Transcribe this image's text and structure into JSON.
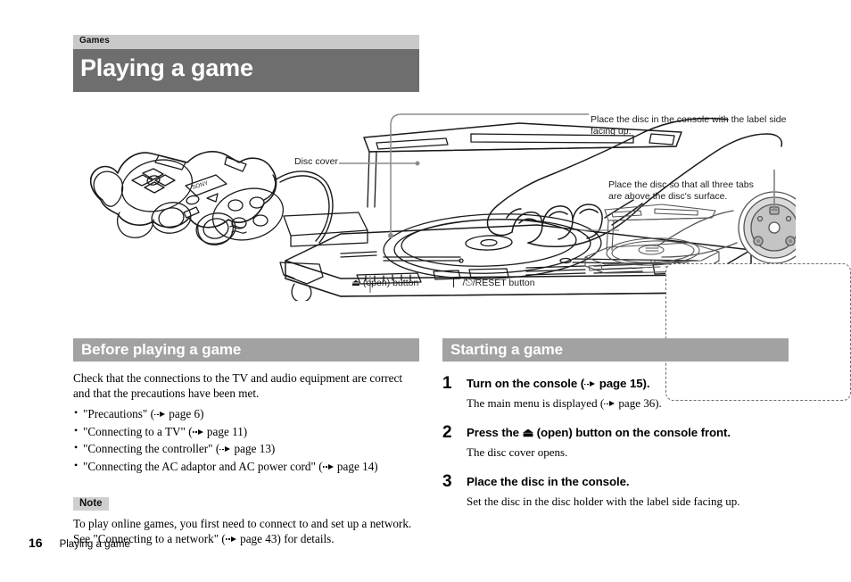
{
  "running_head": {
    "chapter": "Games",
    "title": "Playing a game"
  },
  "figure": {
    "callouts": {
      "top_right": "Place the disc in the console with the label side facing up.",
      "disc_cover": "Disc cover",
      "open_button": "(open) button",
      "open_button_icon": "eject-icon",
      "reset_button": "/RESET button",
      "reset_button_icon": "power-standby-icon"
    },
    "inset": {
      "text": "Place the disc so that all three tabs are above the disc's surface."
    },
    "console_brand": "SONY"
  },
  "left_column": {
    "heading": "Before playing a game",
    "intro": "Check that the connections to the TV and audio equipment are correct and that the precautions have been met.",
    "bullets": [
      {
        "text": "\"Precautions\" (",
        "page": "page 6",
        "tail": ")"
      },
      {
        "text": "\"Connecting to a TV\" (",
        "page": "page 11",
        "tail": ")"
      },
      {
        "text": "\"Connecting the controller\" (",
        "page": "page 13",
        "tail": ")"
      },
      {
        "text": "\"Connecting the AC adaptor and AC power cord\" (",
        "page": "page 14",
        "tail": ")"
      }
    ],
    "note_label": "Note",
    "note_text_a": "To play online games, you first need to connect to and set up a network. See \"Connecting to a network\" (",
    "note_page": "page 43",
    "note_text_b": ") for details."
  },
  "right_column": {
    "heading": "Starting a game",
    "steps": [
      {
        "num": "1",
        "head_a": "Turn on the console (",
        "head_page": "page 15",
        "head_b": ").",
        "sub_a": "The main menu is displayed (",
        "sub_page": "page 36",
        "sub_b": ")."
      },
      {
        "num": "2",
        "head_a": "Press the ",
        "head_icon": "eject-icon",
        "head_b": " (open) button on the console front.",
        "sub_a": "The disc cover opens.",
        "sub_page": "",
        "sub_b": ""
      },
      {
        "num": "3",
        "head_a": "Place the disc in the console.",
        "head_page": "",
        "head_b": "",
        "sub_a": "Set the disc in the disc holder with the label side facing up.",
        "sub_page": "",
        "sub_b": ""
      }
    ]
  },
  "footer": {
    "page_number": "16",
    "title": "Playing a game"
  },
  "colors": {
    "chapter_bar": "#c9c9c9",
    "title_bar": "#6e6e6e",
    "section_bar": "#a2a2a2",
    "note_badge": "#cfcfcf",
    "leader_line": "#8c8c8c",
    "line_art": "#1a1a1a"
  }
}
